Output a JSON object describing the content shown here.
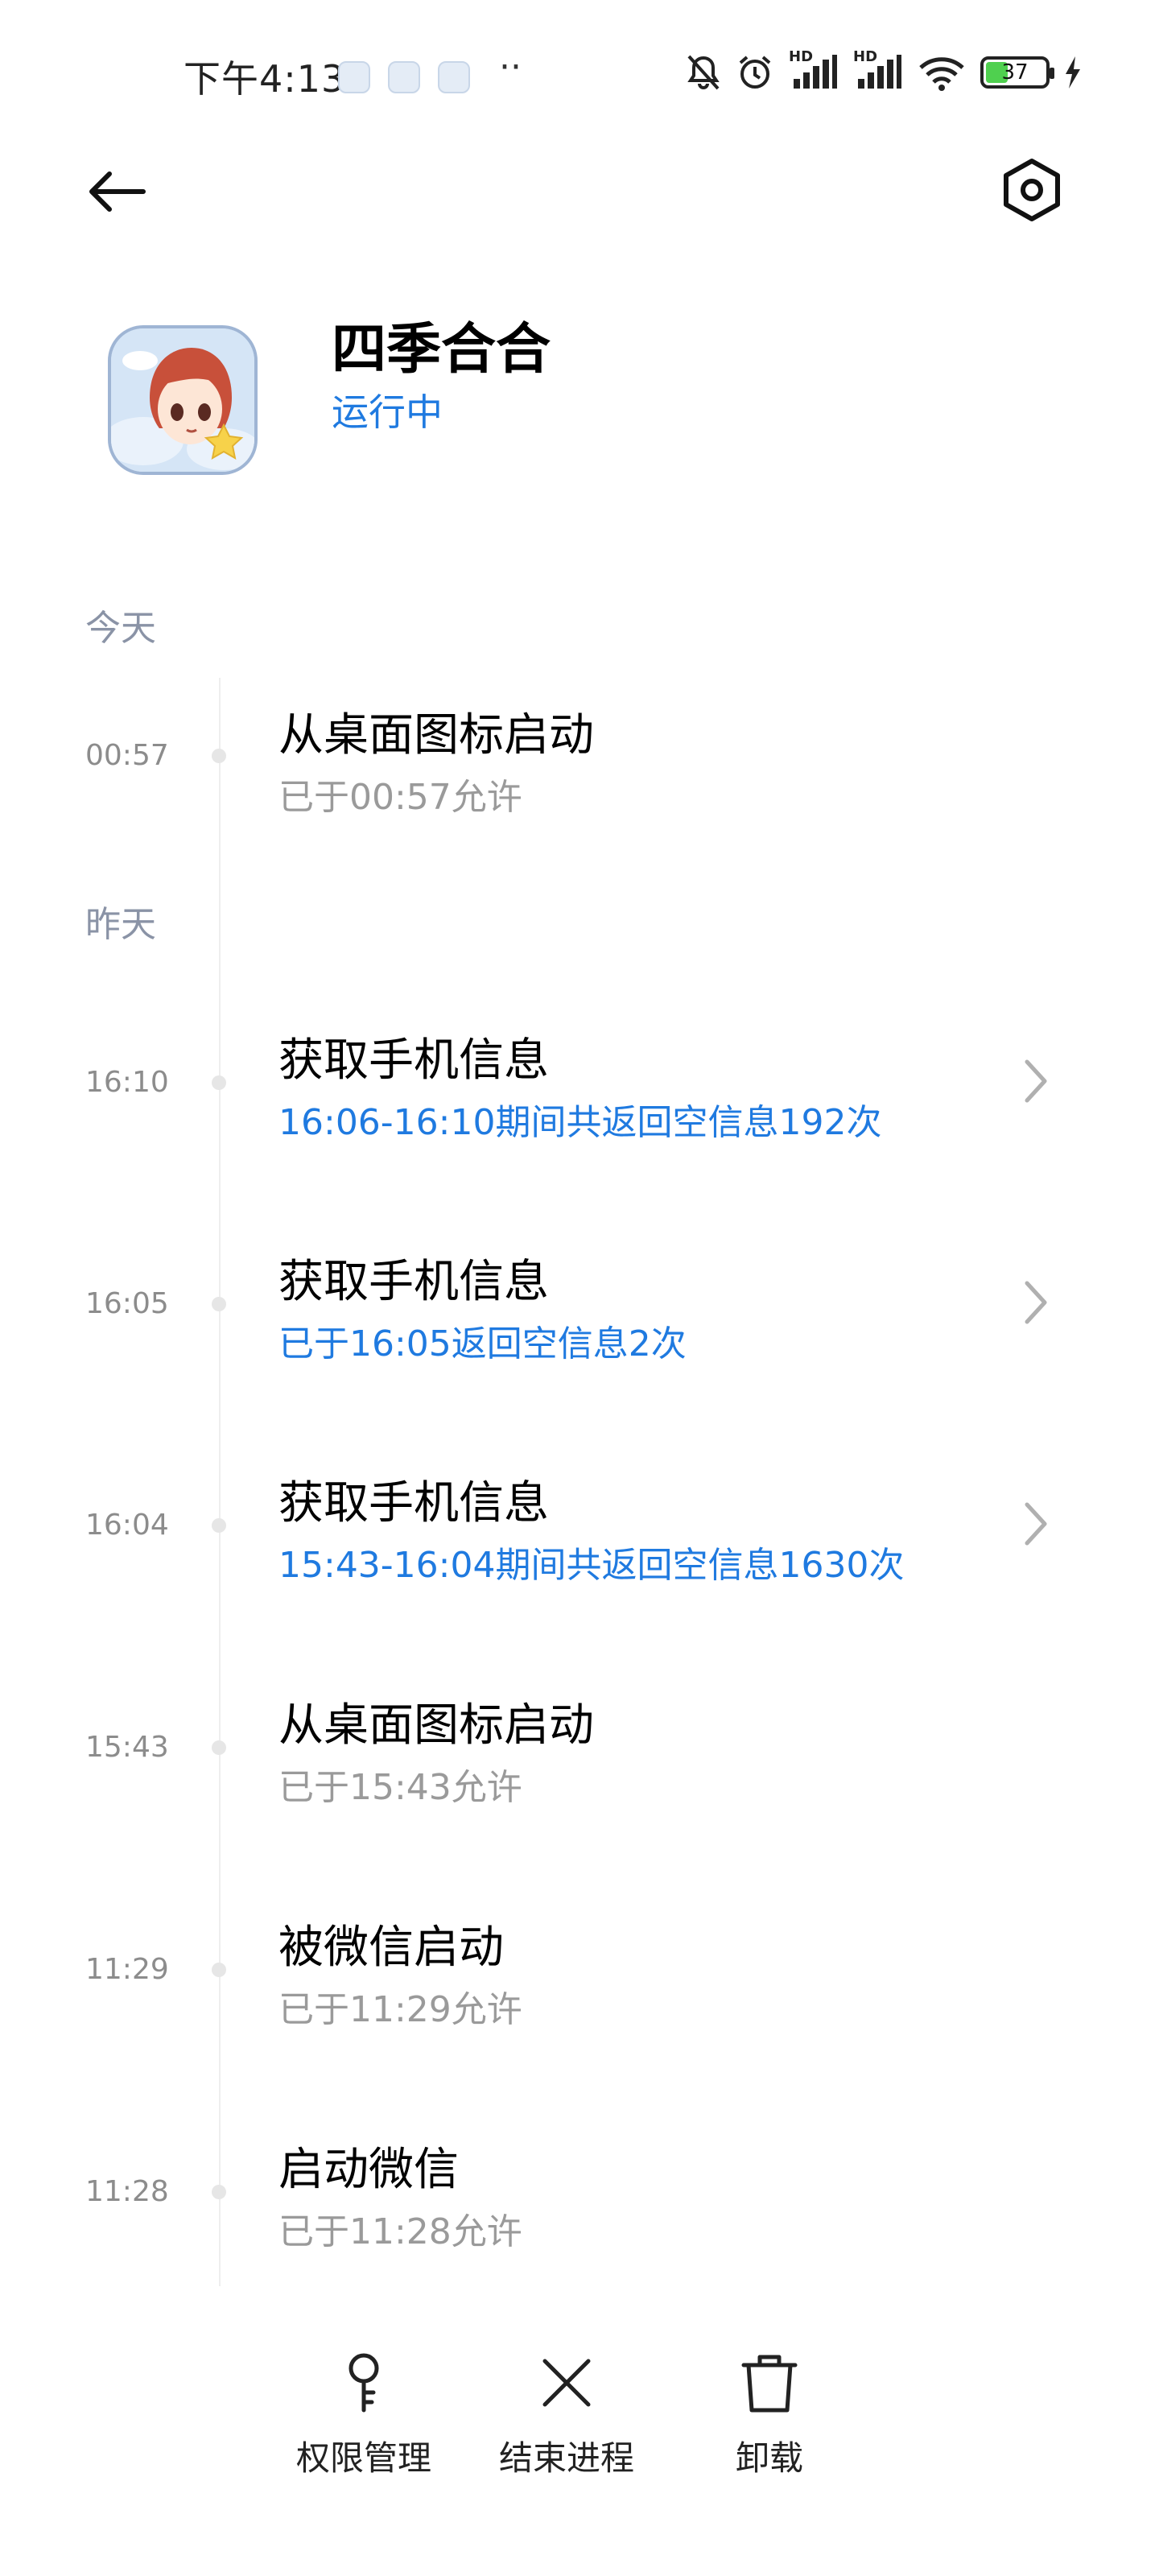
{
  "status_bar": {
    "time": "下午4:13",
    "more_dots": "··",
    "network_labels": [
      "HD",
      "HD"
    ],
    "battery_level": 37,
    "battery_label": "37",
    "battery_color": "#4fd04f"
  },
  "header": {
    "back_icon": "arrow-left-icon",
    "settings_icon": "settings-hex-icon"
  },
  "app": {
    "name": "四季合合",
    "status": "运行中",
    "status_color": "#1f7ae0"
  },
  "timeline": {
    "sections": [
      {
        "label": "今天",
        "entries": [
          {
            "time": "00:57",
            "title": "从桌面图标启动",
            "subtitle": "已于00:57允许",
            "highlight": false,
            "has_chevron": false
          }
        ]
      },
      {
        "label": "昨天",
        "entries": [
          {
            "time": "16:10",
            "title": "获取手机信息",
            "subtitle": "16:06-16:10期间共返回空信息192次",
            "highlight": true,
            "has_chevron": true
          },
          {
            "time": "16:05",
            "title": "获取手机信息",
            "subtitle": "已于16:05返回空信息2次",
            "highlight": true,
            "has_chevron": true
          },
          {
            "time": "16:04",
            "title": "获取手机信息",
            "subtitle": "15:43-16:04期间共返回空信息1630次",
            "highlight": true,
            "has_chevron": true
          },
          {
            "time": "15:43",
            "title": "从桌面图标启动",
            "subtitle": "已于15:43允许",
            "highlight": false,
            "has_chevron": false
          },
          {
            "time": "11:29",
            "title": "被微信启动",
            "subtitle": "已于11:29允许",
            "highlight": false,
            "has_chevron": false
          },
          {
            "time": "11:28",
            "title": "启动微信",
            "subtitle": "已于11:28允许",
            "highlight": false,
            "has_chevron": false
          }
        ]
      }
    ]
  },
  "bottom_actions": [
    {
      "label": "权限管理",
      "icon": "key-icon"
    },
    {
      "label": "结束进程",
      "icon": "close-x-icon"
    },
    {
      "label": "卸载",
      "icon": "trash-icon"
    }
  ]
}
